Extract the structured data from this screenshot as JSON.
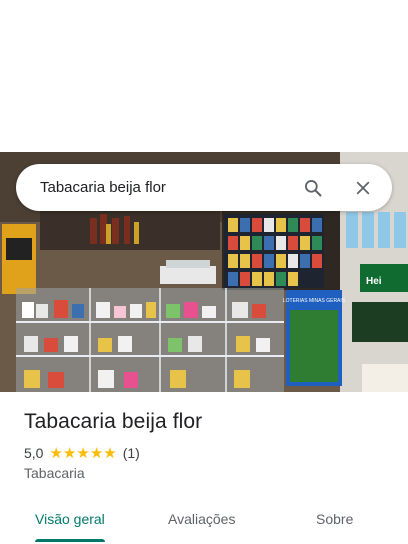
{
  "search": {
    "query": "Tabacaria beija flor"
  },
  "place": {
    "name": "Tabacaria beija flor",
    "rating": "5,0",
    "stars": [
      "★",
      "★",
      "★",
      "★",
      "★"
    ],
    "review_count": "(1)",
    "category": "Tabacaria"
  },
  "tabs": [
    {
      "label": "Visão geral",
      "active": true
    },
    {
      "label": "Avaliações",
      "active": false
    },
    {
      "label": "Sobre",
      "active": false
    }
  ],
  "photo": {
    "sign_text": "LOTERIAS MINAS GERAIS",
    "can_text": "Hei"
  },
  "colors": {
    "accent": "#00796b",
    "star": "#fbbc04"
  },
  "icons": {
    "search": "search-icon",
    "close": "close-icon"
  }
}
